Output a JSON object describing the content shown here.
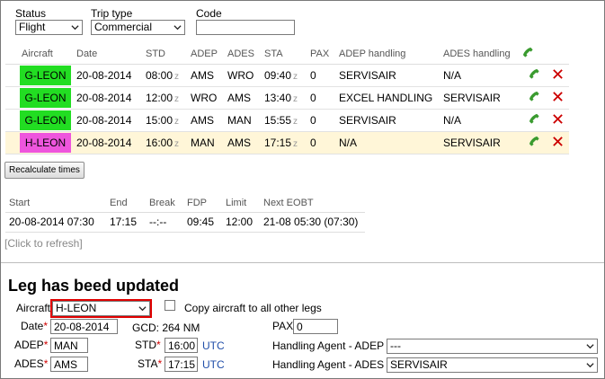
{
  "filters": {
    "status": {
      "label": "Status",
      "value": "Flight"
    },
    "trip_type": {
      "label": "Trip type",
      "value": "Commercial"
    },
    "code": {
      "label": "Code",
      "value": ""
    }
  },
  "legs_table": {
    "headers": [
      "Aircraft",
      "Date",
      "STD",
      "ADEP",
      "ADES",
      "STA",
      "PAX",
      "ADEP handling",
      "ADES handling"
    ],
    "z_suffix": "z",
    "rows": [
      {
        "aircraft": "G-LEON",
        "aircraft_color": "#22dd22",
        "date": "20-08-2014",
        "std": "08:00",
        "adep": "AMS",
        "ades": "WRO",
        "sta": "09:40",
        "pax": "0",
        "adep_handling": "SERVISAIR",
        "ades_handling": "N/A"
      },
      {
        "aircraft": "G-LEON",
        "aircraft_color": "#22dd22",
        "date": "20-08-2014",
        "std": "12:00",
        "adep": "WRO",
        "ades": "AMS",
        "sta": "13:40",
        "pax": "0",
        "adep_handling": "EXCEL HANDLING",
        "ades_handling": "SERVISAIR"
      },
      {
        "aircraft": "G-LEON",
        "aircraft_color": "#22dd22",
        "date": "20-08-2014",
        "std": "15:00",
        "adep": "AMS",
        "ades": "MAN",
        "sta": "15:55",
        "pax": "0",
        "adep_handling": "SERVISAIR",
        "ades_handling": "N/A"
      },
      {
        "aircraft": "H-LEON",
        "aircraft_color": "#ee55dd",
        "date": "20-08-2014",
        "std": "16:00",
        "adep": "MAN",
        "ades": "AMS",
        "sta": "17:15",
        "pax": "0",
        "adep_handling": "N/A",
        "ades_handling": "SERVISAIR"
      }
    ]
  },
  "recalculate_label": "Recalculate times",
  "duty": {
    "headers": [
      "Start",
      "End",
      "Break",
      "FDP",
      "Limit",
      "Next EOBT"
    ],
    "row": [
      "20-08-2014 07:30",
      "17:15",
      "--:--",
      "09:45",
      "12:00",
      "21-08 05:30 (07:30)"
    ]
  },
  "refresh_label": "[Click to refresh]",
  "form": {
    "heading": "Leg has beed updated",
    "aircraft_label": "Aircraft",
    "aircraft_value": "H-LEON",
    "copy_label": "Copy aircraft to all other legs",
    "date_label": "Date",
    "date_value": "20-08-2014",
    "gcd_text": "GCD: 264 NM",
    "pax_label": "PAX",
    "pax_value": "0",
    "adep_label": "ADEP",
    "adep_value": "MAN",
    "std_label": "STD",
    "std_value": "16:00",
    "ades_label": "ADES",
    "ades_value": "AMS",
    "sta_label": "STA",
    "sta_value": "17:15",
    "utc": "UTC",
    "handling_adep_label": "Handling Agent - ADEP",
    "handling_adep_value": "---",
    "handling_ades_label": "Handling Agent - ADES",
    "handling_ades_value": "SERVISAIR",
    "required_mark": "*"
  },
  "colors": {
    "accent_red": "#e00000",
    "phone_green": "#2e8b2e",
    "delete_red": "#cc0000",
    "utc_blue": "#1f4da8"
  }
}
